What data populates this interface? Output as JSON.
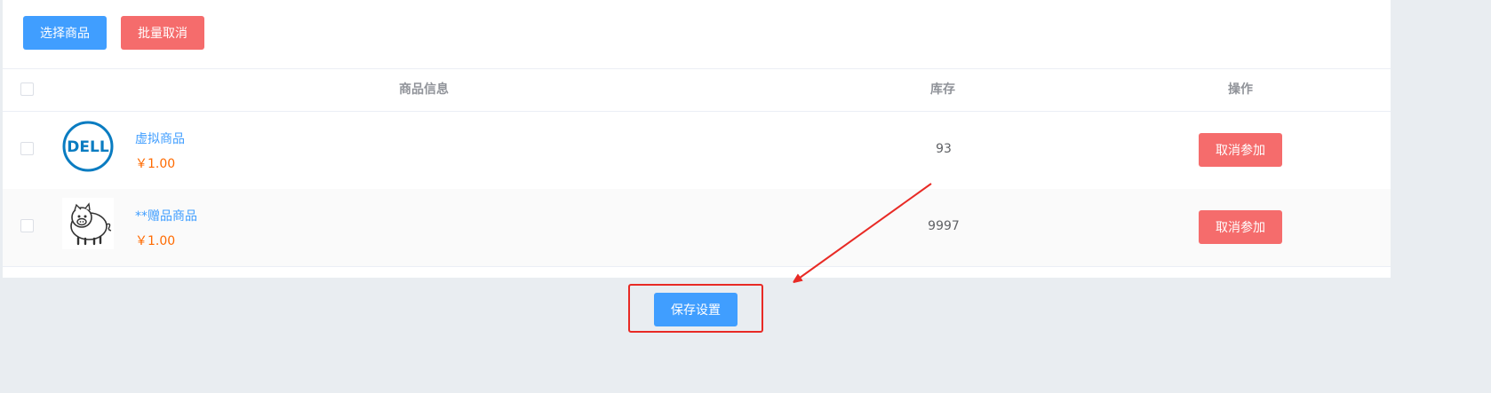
{
  "toolbar": {
    "select_label": "选择商品",
    "batch_cancel_label": "批量取消"
  },
  "table": {
    "headers": {
      "info": "商品信息",
      "stock": "库存",
      "operation": "操作"
    },
    "rows": [
      {
        "name": "虚拟商品",
        "price": "￥1.00",
        "stock": "93",
        "action": "取消参加",
        "thumb": "dell-logo-icon"
      },
      {
        "name": "**赠品商品",
        "price": "￥1.00",
        "stock": "9997",
        "action": "取消参加",
        "thumb": "pig-icon"
      }
    ]
  },
  "footer": {
    "save_label": "保存设置"
  },
  "colors": {
    "primary": "#409eff",
    "danger": "#f56c6c",
    "price": "#ff6a00",
    "annotation": "#e82a25"
  }
}
